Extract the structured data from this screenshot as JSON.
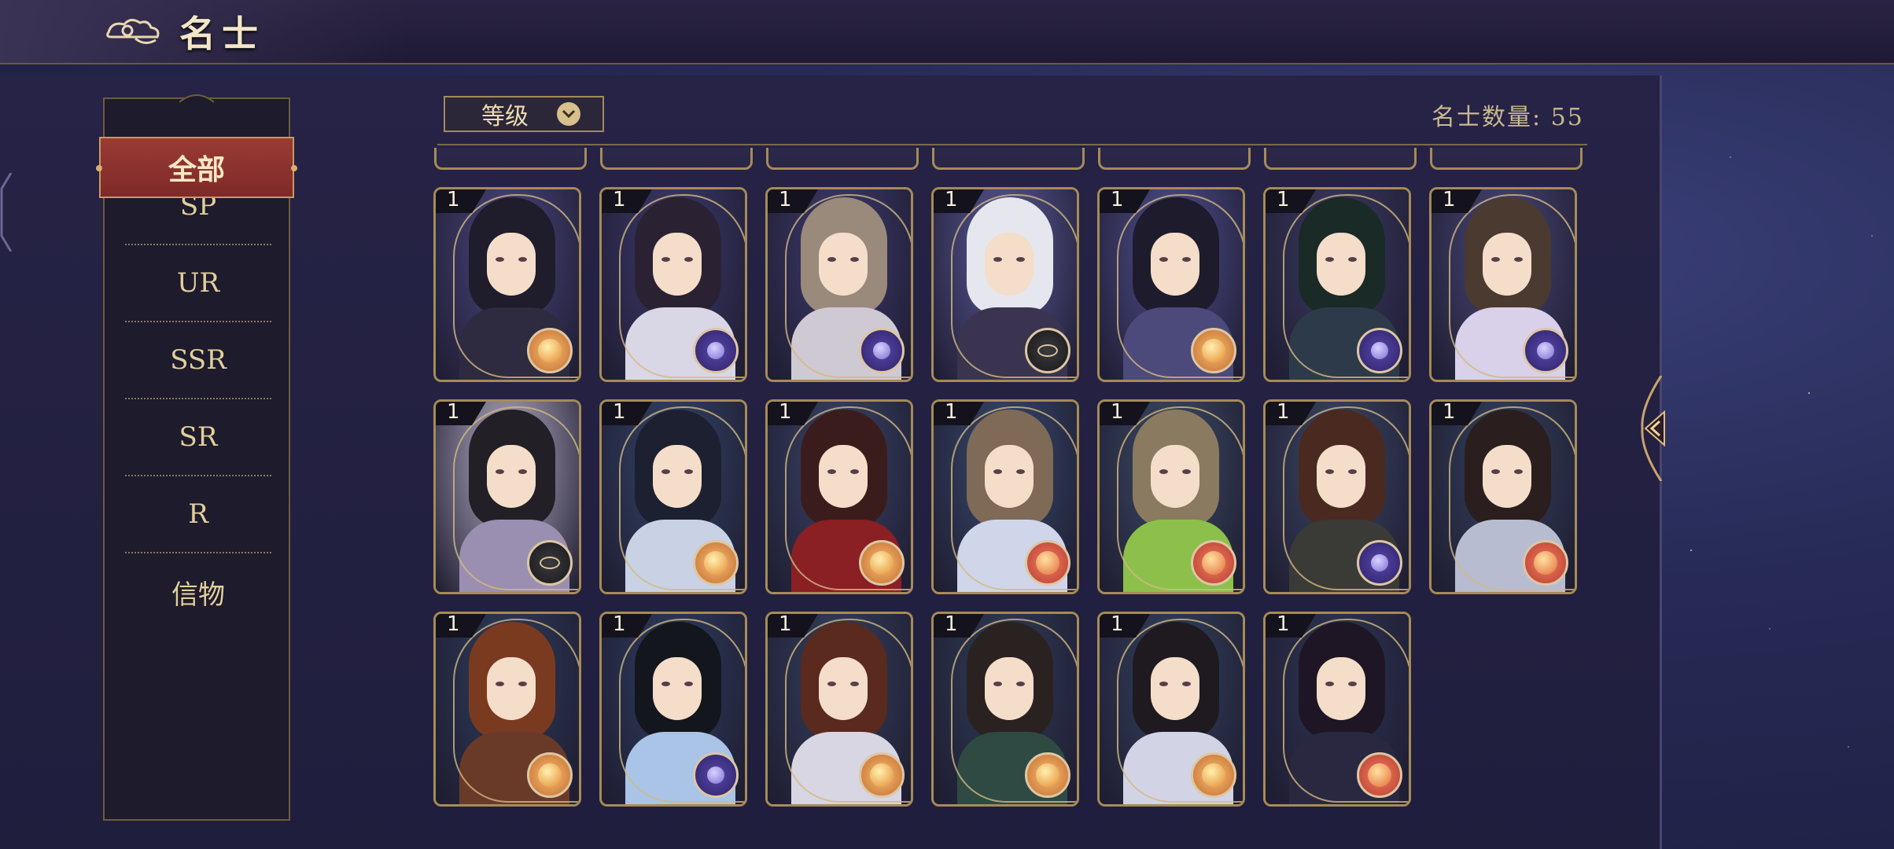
{
  "header": {
    "title": "名士"
  },
  "sidebar": {
    "active": "全部",
    "items": [
      {
        "label": "SP"
      },
      {
        "label": "UR"
      },
      {
        "label": "SSR"
      },
      {
        "label": "SR"
      },
      {
        "label": "R"
      },
      {
        "label": "信物"
      }
    ]
  },
  "filter": {
    "sort_label": "等级",
    "count_label": "名士数量: 55"
  },
  "cards": [
    {
      "level": "1",
      "emblem": "gold-orb-icon",
      "bg": "#4a4680",
      "hair": "#1f1d2c",
      "body": "#2e2a40"
    },
    {
      "level": "1",
      "emblem": "purple-orb-icon",
      "bg": "#3d3a6e",
      "hair": "#2a2233",
      "body": "#d9d6e6"
    },
    {
      "level": "1",
      "emblem": "purple-orb-icon",
      "bg": "#3e3b6e",
      "hair": "#9a8a7c",
      "body": "#cfc9d3"
    },
    {
      "level": "1",
      "emblem": "dark-compass-icon",
      "bg": "#5a5a9a",
      "hair": "#e6e6ee",
      "body": "#3a3450"
    },
    {
      "level": "1",
      "emblem": "gold-orb-icon",
      "bg": "#505090",
      "hair": "#1e1c2c",
      "body": "#4c4a7a"
    },
    {
      "level": "1",
      "emblem": "purple-orb-icon",
      "bg": "#3b3a62",
      "hair": "#1a2a26",
      "body": "#2d3a4a"
    },
    {
      "level": "1",
      "emblem": "purple-orb-icon",
      "bg": "#4a4778",
      "hair": "#4a3a30",
      "body": "#d9d0ea"
    },
    {
      "level": "1",
      "emblem": "dark-compass-icon",
      "bg": "#b8b0c8",
      "hair": "#222026",
      "body": "#9a8fb0"
    },
    {
      "level": "1",
      "emblem": "gold-orb-icon",
      "bg": "#34456a",
      "hair": "#1c2030",
      "body": "#c8d2e4"
    },
    {
      "level": "1",
      "emblem": "gold-orb-icon",
      "bg": "#3a4568",
      "hair": "#3b1c1c",
      "body": "#8a1f24"
    },
    {
      "level": "1",
      "emblem": "red-orb-icon",
      "bg": "#384a6e",
      "hair": "#7e6a56",
      "body": "#cfd6ea"
    },
    {
      "level": "1",
      "emblem": "red-orb-icon",
      "bg": "#3c4c66",
      "hair": "#8a7a60",
      "body": "#8cc04a"
    },
    {
      "level": "1",
      "emblem": "purple-orb-icon",
      "bg": "#3b4766",
      "hair": "#4a2a20",
      "body": "#3a3a36"
    },
    {
      "level": "1",
      "emblem": "red-orb-icon",
      "bg": "#34425e",
      "hair": "#2a1e1e",
      "body": "#b8bcd0"
    },
    {
      "level": "1",
      "emblem": "gold-orb-icon",
      "bg": "#2e3d5c",
      "hair": "#7a3a20",
      "body": "#6a3a28"
    },
    {
      "level": "1",
      "emblem": "purple-orb-icon",
      "bg": "#2e3e60",
      "hair": "#14161e",
      "body": "#a9c4e6"
    },
    {
      "level": "1",
      "emblem": "gold-orb-icon",
      "bg": "#35415e",
      "hair": "#5a2a1e",
      "body": "#d8d6e2"
    },
    {
      "level": "1",
      "emblem": "gold-orb-icon",
      "bg": "#2f3d58",
      "hair": "#2a2220",
      "body": "#2e4a42"
    },
    {
      "level": "1",
      "emblem": "gold-orb-icon",
      "bg": "#33425e",
      "hair": "#1e1a20",
      "body": "#d2d4e6"
    },
    {
      "level": "1",
      "emblem": "red-orb-icon",
      "bg": "#2e3654",
      "hair": "#1e1624",
      "body": "#2a2840"
    }
  ],
  "colors": {
    "accent_red": "#8c302c",
    "gold_border": "#a58b57",
    "panel": "#262346"
  }
}
